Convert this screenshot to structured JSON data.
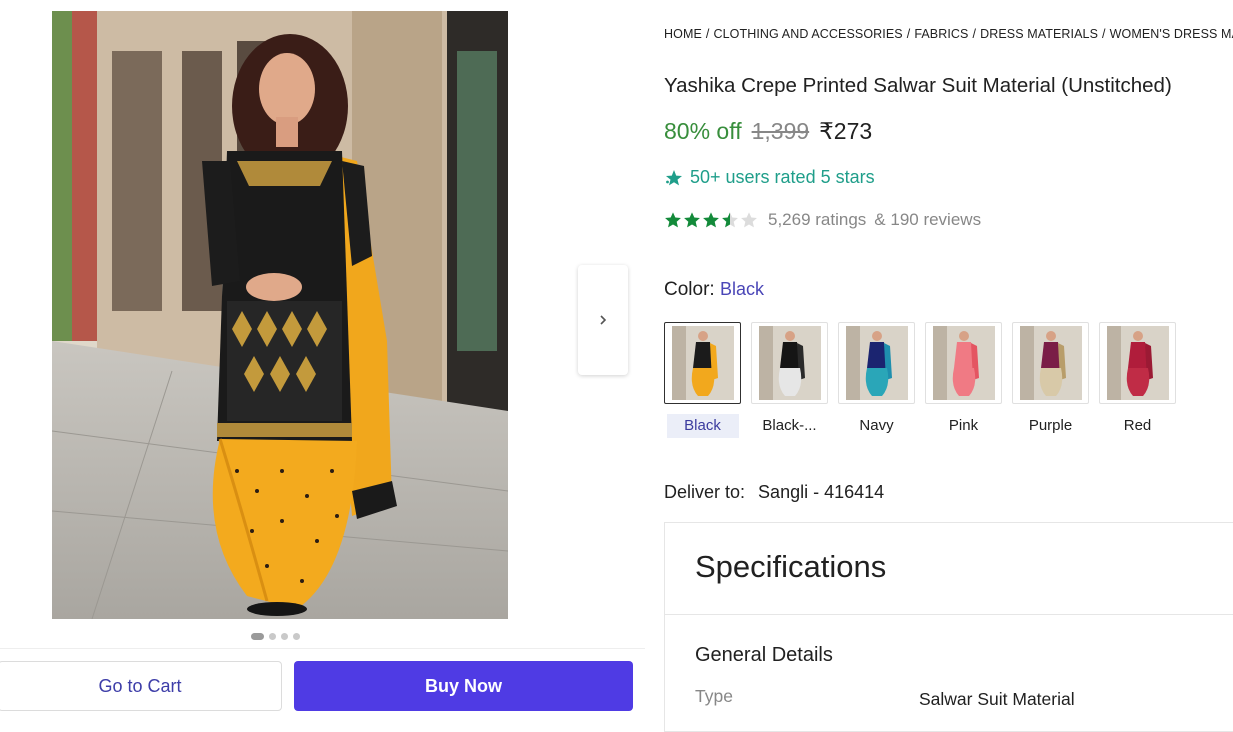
{
  "breadcrumb": [
    "HOME",
    "CLOTHING AND ACCESSORIES",
    "FABRICS",
    "DRESS MATERIALS",
    "WOMEN'S DRESS MATERIALS"
  ],
  "product": {
    "title": "Yashika Crepe Printed Salwar Suit Material (Unstitched)",
    "discount": "80% off",
    "mrp": "1,399",
    "price": "₹273"
  },
  "promo": {
    "text": "50+ users rated 5 stars",
    "icon": "sparkle-star-icon"
  },
  "rating": {
    "value": 3.5,
    "max": 5,
    "ratings_text": "5,269 ratings",
    "reviews_text": "& 190 reviews"
  },
  "color": {
    "label": "Color:",
    "selected": "Black",
    "options": [
      {
        "name": "Black",
        "top": "#1b1b1b",
        "bottom": "#f2a81d",
        "scarf": "#f2a81d"
      },
      {
        "name": "Black-...",
        "top": "#151515",
        "bottom": "#e6e6e6",
        "scarf": "#2a2a2a"
      },
      {
        "name": "Navy",
        "top": "#1b2470",
        "bottom": "#2aa6b8",
        "scarf": "#1f8fae"
      },
      {
        "name": "Pink",
        "top": "#f07a84",
        "bottom": "#f07a84",
        "scarf": "#e45562"
      },
      {
        "name": "Purple",
        "top": "#7a1d47",
        "bottom": "#d8c9a8",
        "scarf": "#b89d6a"
      },
      {
        "name": "Red",
        "top": "#b01d3b",
        "bottom": "#c02c46",
        "scarf": "#9b1a34"
      }
    ]
  },
  "delivery": {
    "label": "Deliver to:",
    "pincode": "Sangli - 416414"
  },
  "specs": {
    "title": "Specifications",
    "section": "General Details",
    "rows": [
      {
        "key": "Type",
        "value": "Salwar Suit Material"
      }
    ]
  },
  "gallery": {
    "total": 4,
    "active": 0
  },
  "actions": {
    "cart": "Go to Cart",
    "buy": "Buy Now"
  },
  "colors": {
    "accent": "#4f3be4",
    "discount": "#388e3c",
    "star": "#138a3a",
    "promo": "#1f9e8a"
  }
}
